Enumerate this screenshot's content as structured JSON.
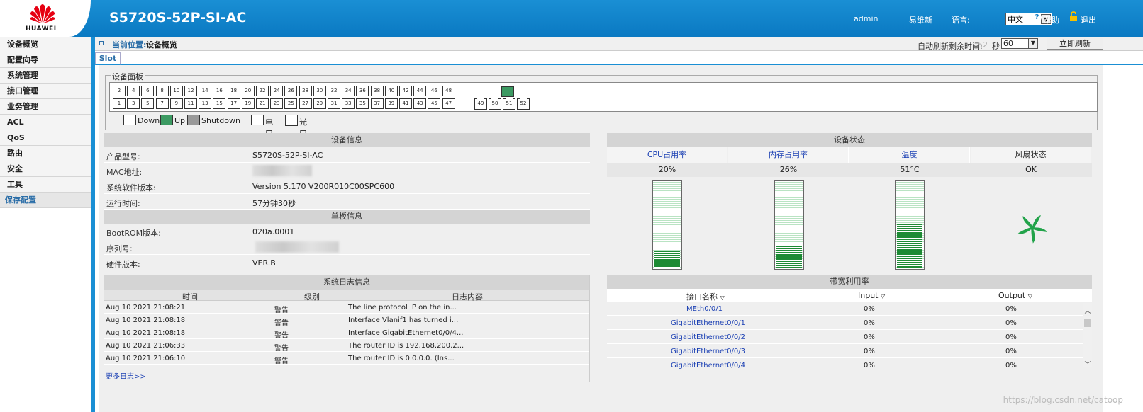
{
  "header": {
    "logo_text": "HUAWEI",
    "model": "S5720S-52P-SI-AC",
    "user": "admin",
    "easy_ops": "易维新",
    "lang_label": "语言:",
    "lang_value": "中文",
    "help": "帮助",
    "logout": "退出"
  },
  "sidebar": {
    "items": [
      {
        "label": "设备概览"
      },
      {
        "label": "配置向导"
      },
      {
        "label": "系统管理"
      },
      {
        "label": "接口管理"
      },
      {
        "label": "业务管理"
      },
      {
        "label": "ACL"
      },
      {
        "label": "QoS"
      },
      {
        "label": "路由"
      },
      {
        "label": "安全"
      },
      {
        "label": "工具"
      },
      {
        "label": "保存配置"
      }
    ]
  },
  "location": {
    "label": "当前位置:",
    "value": "设备概览",
    "refresh_label": "自动刷新剩余时间:",
    "refresh_remaining": "52",
    "refresh_sec": "秒",
    "refresh_interval": "60",
    "refresh_button": "立即刷新"
  },
  "tab": {
    "label": "Slot 0"
  },
  "panel": {
    "legend": "设备面板",
    "top_ports": [
      "2",
      "4",
      "6",
      "8",
      "10",
      "12",
      "14",
      "16",
      "18",
      "20",
      "22",
      "24",
      "26",
      "28",
      "30",
      "32",
      "34",
      "36",
      "38",
      "40",
      "42",
      "44",
      "46",
      "48"
    ],
    "bottom_ports": [
      "1",
      "3",
      "5",
      "7",
      "9",
      "11",
      "13",
      "15",
      "17",
      "19",
      "21",
      "23",
      "25",
      "27",
      "29",
      "31",
      "33",
      "35",
      "37",
      "39",
      "41",
      "43",
      "45",
      "47"
    ],
    "fiber_ports": [
      "49",
      "50",
      "51",
      "52"
    ],
    "status_legend": {
      "down": "Down",
      "up": "Up",
      "shutdown": "Shutdown",
      "electric": "电口",
      "optical": "光口"
    }
  },
  "device_info": {
    "title": "设备信息",
    "rows": [
      {
        "k": "产品型号:",
        "v": "S5720S-52P-SI-AC"
      },
      {
        "k": "MAC地址:",
        "v": ""
      },
      {
        "k": "系统软件版本:",
        "v": "Version 5.170 V200R010C00SPC600"
      },
      {
        "k": "运行时间:",
        "v": "57分钟30秒"
      }
    ],
    "board_title": "单板信息",
    "board_rows": [
      {
        "k": "BootROM版本:",
        "v": "020a.0001"
      },
      {
        "k": "序列号:",
        "v": ""
      },
      {
        "k": "硬件版本:",
        "v": "VER.B"
      }
    ]
  },
  "log": {
    "title": "系统日志信息",
    "col_time": "时间",
    "col_level": "级别",
    "col_content": "日志内容",
    "rows": [
      {
        "time": "Aug 10 2021 21:08:21",
        "level": "警告",
        "content": "The line protocol IP on the in..."
      },
      {
        "time": "Aug 10 2021 21:08:18",
        "level": "警告",
        "content": "Interface Vlanif1 has turned i..."
      },
      {
        "time": "Aug 10 2021 21:08:18",
        "level": "警告",
        "content": "Interface GigabitEthernet0/0/4..."
      },
      {
        "time": "Aug 10 2021 21:06:33",
        "level": "警告",
        "content": "The router ID is 192.168.200.2..."
      },
      {
        "time": "Aug 10 2021 21:06:10",
        "level": "警告",
        "content": "The router ID is 0.0.0.0. (Ins..."
      }
    ],
    "more": "更多日志>>"
  },
  "status": {
    "title": "设备状态",
    "cpu_label": "CPU占用率",
    "mem_label": "内存占用率",
    "temp_label": "温度",
    "fan_label": "风扇状态",
    "cpu_value": "20%",
    "mem_value": "26%",
    "temp_value": "51°C",
    "fan_value": "OK",
    "cpu_level": 0.2,
    "mem_level": 0.26,
    "temp_level": 0.51,
    "accent": "#1d8a34"
  },
  "bandwidth": {
    "title": "带宽利用率",
    "col_name": "接口名称",
    "col_input": "Input",
    "col_output": "Output",
    "rows": [
      {
        "name": "MEth0/0/1",
        "input": "0%",
        "output": "0%"
      },
      {
        "name": "GigabitEthernet0/0/1",
        "input": "0%",
        "output": "0%"
      },
      {
        "name": "GigabitEthernet0/0/2",
        "input": "0%",
        "output": "0%"
      },
      {
        "name": "GigabitEthernet0/0/3",
        "input": "0%",
        "output": "0%"
      },
      {
        "name": "GigabitEthernet0/0/4",
        "input": "0%",
        "output": "0%"
      }
    ]
  },
  "watermark": "https://blog.csdn.net/catoop"
}
